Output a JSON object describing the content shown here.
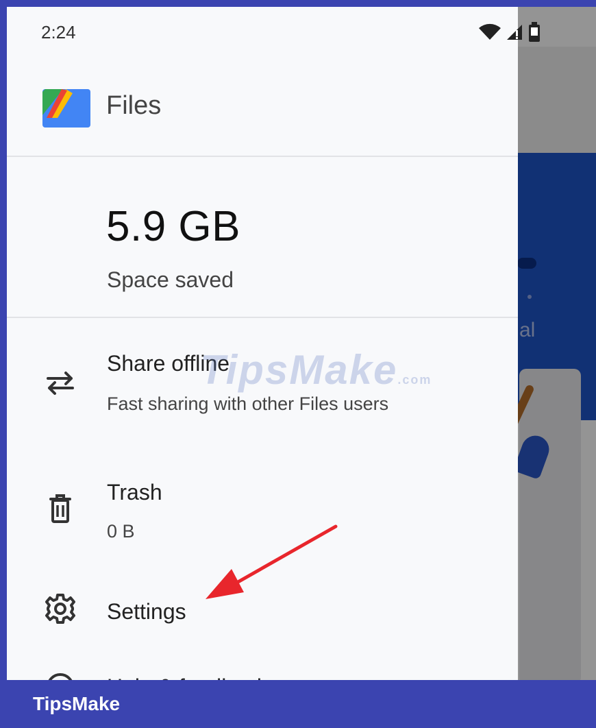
{
  "status_bar": {
    "time": "2:24",
    "icons": [
      "wifi-icon",
      "signal-icon",
      "battery-icon"
    ]
  },
  "app": {
    "name": "Files",
    "logo_colors": {
      "blue": "#4285f4",
      "green": "#34a853",
      "yellow": "#fbbc05",
      "red": "#ea4335"
    }
  },
  "stats": {
    "value": "5.9 GB",
    "label": "Space saved"
  },
  "menu": {
    "items": [
      {
        "title": "Share offline",
        "subtitle": "Fast sharing with other Files users",
        "icon": "swap-arrows-icon"
      },
      {
        "title": "Trash",
        "subtitle": "0 B",
        "icon": "trash-icon"
      },
      {
        "title": "Settings",
        "icon": "gear-icon"
      },
      {
        "title": "Help & feedback",
        "icon": "help-icon"
      }
    ]
  },
  "watermark": {
    "text": "TipsMake",
    "suffix": ".com"
  },
  "footer": {
    "brand": "TipsMake"
  },
  "colors": {
    "frame": "#3b44b0",
    "annotation_arrow": "#e8262c"
  }
}
